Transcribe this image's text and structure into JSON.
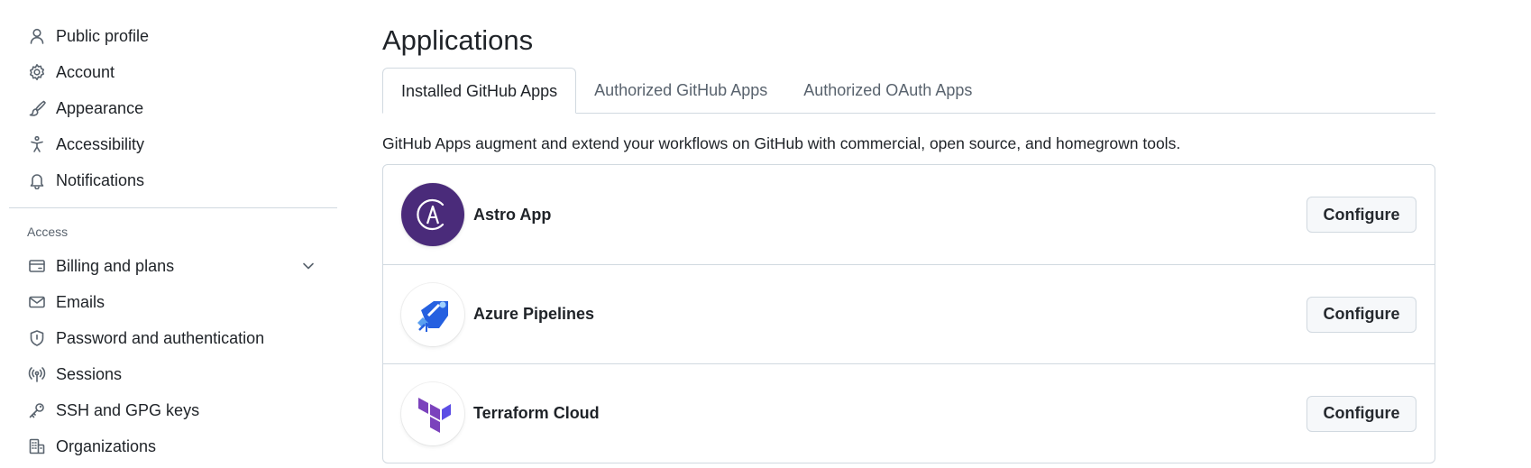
{
  "sidebar": {
    "items": [
      {
        "label": "Public profile",
        "icon": "person-icon"
      },
      {
        "label": "Account",
        "icon": "gear-icon"
      },
      {
        "label": "Appearance",
        "icon": "paintbrush-icon"
      },
      {
        "label": "Accessibility",
        "icon": "accessibility-icon"
      },
      {
        "label": "Notifications",
        "icon": "bell-icon"
      }
    ],
    "access_heading": "Access",
    "access_items": [
      {
        "label": "Billing and plans",
        "icon": "credit-card-icon"
      },
      {
        "label": "Emails",
        "icon": "mail-icon"
      },
      {
        "label": "Password and authentication",
        "icon": "shield-icon"
      },
      {
        "label": "Sessions",
        "icon": "broadcast-icon"
      },
      {
        "label": "SSH and GPG keys",
        "icon": "key-icon"
      },
      {
        "label": "Organizations",
        "icon": "organization-icon"
      }
    ]
  },
  "main": {
    "title": "Applications",
    "tabs": [
      {
        "label": "Installed GitHub Apps",
        "active": true
      },
      {
        "label": "Authorized GitHub Apps",
        "active": false
      },
      {
        "label": "Authorized OAuth Apps",
        "active": false
      }
    ],
    "description": "GitHub Apps augment and extend your workflows on GitHub with commercial, open source, and homegrown tools.",
    "apps": [
      {
        "name": "Astro App",
        "button": "Configure",
        "logo": "astro-logo",
        "logo_bg": "#4a2b7a"
      },
      {
        "name": "Azure Pipelines",
        "button": "Configure",
        "logo": "azure-pipelines-logo",
        "logo_bg": "#ffffff"
      },
      {
        "name": "Terraform Cloud",
        "button": "Configure",
        "logo": "terraform-logo",
        "logo_bg": "#ffffff"
      }
    ]
  },
  "colors": {
    "border": "#d1d9e0",
    "muted_text": "#59636e",
    "text": "#1f2328",
    "button_bg": "#f6f8fa",
    "terraform_purple": "#7b42bc",
    "azure_blue": "#2560e0"
  }
}
